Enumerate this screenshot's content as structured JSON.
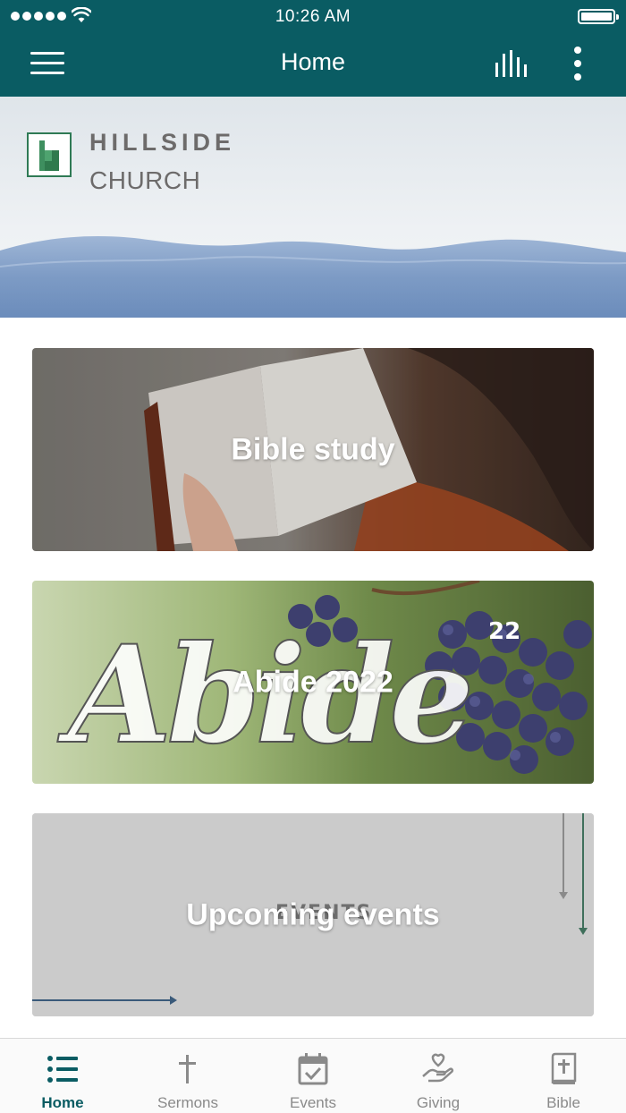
{
  "status_bar": {
    "time": "10:26 AM"
  },
  "app_bar": {
    "title": "Home"
  },
  "banner": {
    "line1": "HILLSIDE",
    "line2": "CHURCH"
  },
  "cards": [
    {
      "label": "Bible study"
    },
    {
      "label": "Abide 2022",
      "art_text": "Abide",
      "art_sup": "22"
    },
    {
      "label": "Upcoming events",
      "art_text": "EVENTS"
    }
  ],
  "bottom_nav": [
    {
      "label": "Home",
      "icon": "list-icon",
      "active": true
    },
    {
      "label": "Sermons",
      "icon": "cross-icon"
    },
    {
      "label": "Events",
      "icon": "calendar-check-icon"
    },
    {
      "label": "Giving",
      "icon": "heart-hand-icon"
    },
    {
      "label": "Bible",
      "icon": "bible-book-icon"
    }
  ],
  "colors": {
    "primary": "#0a5c63",
    "nav_inactive": "#8a8a8a",
    "events_bg": "#cbcbcb"
  }
}
